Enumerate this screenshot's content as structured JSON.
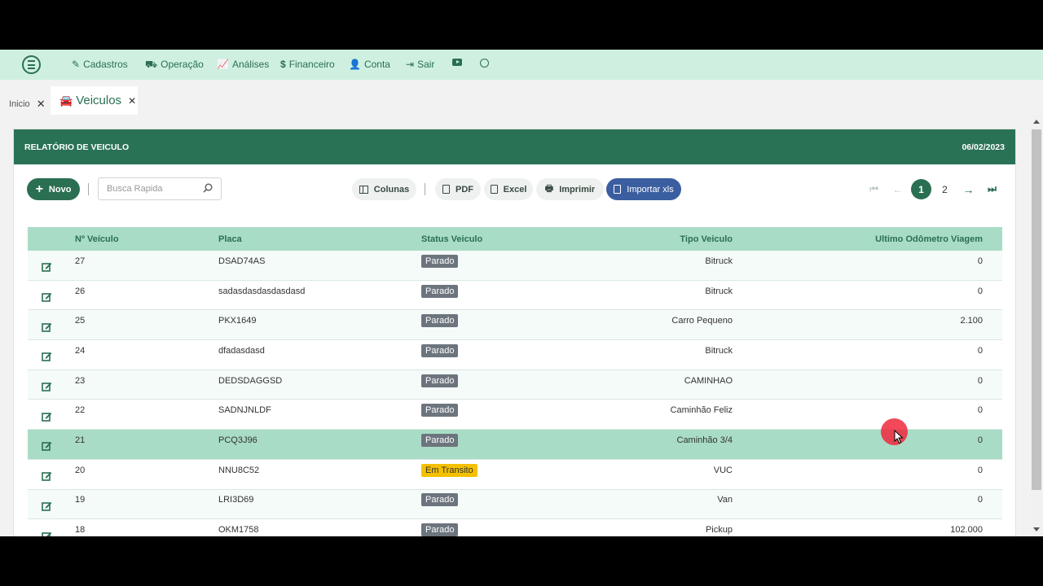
{
  "nav": {
    "items": [
      {
        "label": "Cadastros",
        "icon": "edit-icon"
      },
      {
        "label": "Operação",
        "icon": "truck-icon"
      },
      {
        "label": "Análises",
        "icon": "chart-line-icon"
      },
      {
        "label": "Financeiro",
        "icon": "dollar-icon"
      },
      {
        "label": "Conta",
        "icon": "user-gear-icon"
      },
      {
        "label": "Sair",
        "icon": "sign-out-icon"
      }
    ],
    "youtube_icon": "youtube-icon",
    "whatsapp_icon": "whatsapp-icon"
  },
  "tabs": {
    "inicio": "Inicio",
    "veiculos": "Veiculos"
  },
  "card": {
    "title": "RELATÓRIO DE VEICULO",
    "date": "06/02/2023"
  },
  "toolbar": {
    "novo": "Novo",
    "search_placeholder": "Busca Rapida",
    "colunas": "Colunas",
    "pdf": "PDF",
    "excel": "Excel",
    "imprimir": "Imprimir",
    "importar": "Importar xls"
  },
  "pagination": {
    "pages": [
      "1",
      "2"
    ],
    "current": "1"
  },
  "table": {
    "headers": {
      "num": "Nº Veículo",
      "placa": "Placa",
      "status": "Status Veiculo",
      "tipo": "Tipo Veiculo",
      "odometro": "Ultimo Odômetro Viagem"
    },
    "rows": [
      {
        "num": "27",
        "placa": "DSAD74AS",
        "status": "Parado",
        "tipo": "Bitruck",
        "odometro": "0"
      },
      {
        "num": "26",
        "placa": "sadasdasdasdasdasd",
        "status": "Parado",
        "tipo": "Bitruck",
        "odometro": "0"
      },
      {
        "num": "25",
        "placa": "PKX1649",
        "status": "Parado",
        "tipo": "Carro Pequeno",
        "odometro": "2.100"
      },
      {
        "num": "24",
        "placa": "dfadasdasd",
        "status": "Parado",
        "tipo": "Bitruck",
        "odometro": "0"
      },
      {
        "num": "23",
        "placa": "DEDSDAGGSD",
        "status": "Parado",
        "tipo": "CAMINHAO",
        "odometro": "0"
      },
      {
        "num": "22",
        "placa": "SADNJNLDF",
        "status": "Parado",
        "tipo": "Caminhão Feliz",
        "odometro": "0"
      },
      {
        "num": "21",
        "placa": "PCQ3J96",
        "status": "Parado",
        "tipo": "Caminhão 3/4",
        "odometro": "0"
      },
      {
        "num": "20",
        "placa": "NNU8C52",
        "status": "Em Transito",
        "tipo": "VUC",
        "odometro": "0"
      },
      {
        "num": "19",
        "placa": "LRI3D69",
        "status": "Parado",
        "tipo": "Van",
        "odometro": "0"
      },
      {
        "num": "18",
        "placa": "OKM1758",
        "status": "Parado",
        "tipo": "Pickup",
        "odometro": "102.000"
      }
    ]
  },
  "colors": {
    "primary": "#2a6f52",
    "header_bg": "#2a7256",
    "nav_bg": "#cff0e0",
    "table_header_bg": "#a9dcc6",
    "import_button": "#3a5ea0",
    "badge_parado": "#6c757d",
    "badge_transito": "#f5c000"
  }
}
